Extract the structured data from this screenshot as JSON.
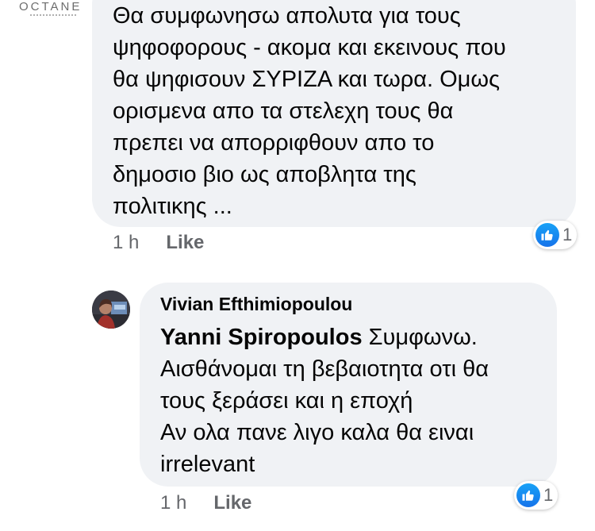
{
  "comment": {
    "avatar": {
      "logo_text": "OCTANE",
      "icon": "company-logo"
    },
    "lines": [
      "Θα συμφωνησω απολυτα για τους",
      "ψηφοφορους - ακομα και εκεινους που",
      "θα ψηφισουν ΣΥΡΙΖΑ και τωρα. Ομως",
      "ορισμενα απο τα στελεχη τους θα",
      "πρεπει να απορριφθουν απο το",
      "δημοσιο βιο ως αποβλητα της",
      "πολιτικης ..."
    ],
    "time": "1 h",
    "like_label": "Like",
    "reaction": {
      "icon": "thumbs-up-icon",
      "count": "1"
    }
  },
  "reply": {
    "author": "Vivian Efthimiopoulou",
    "mention": "Yanni Spiropoulos",
    "first_line_rest": " Συμφωνω.",
    "lines": [
      "Αισθάνομαι τη βεβαιοτητα οτι θα",
      "τους ξεράσει και η εποχή",
      "Αν ολα πανε λιγο καλα θα ειναι",
      "irrelevant"
    ],
    "time": "1 h",
    "like_label": "Like",
    "reaction": {
      "icon": "thumbs-up-icon",
      "count": "1"
    }
  },
  "colors": {
    "bubble_bg": "#f0f2f5",
    "meta_text": "#65676b",
    "like_blue": "#1673ea"
  }
}
